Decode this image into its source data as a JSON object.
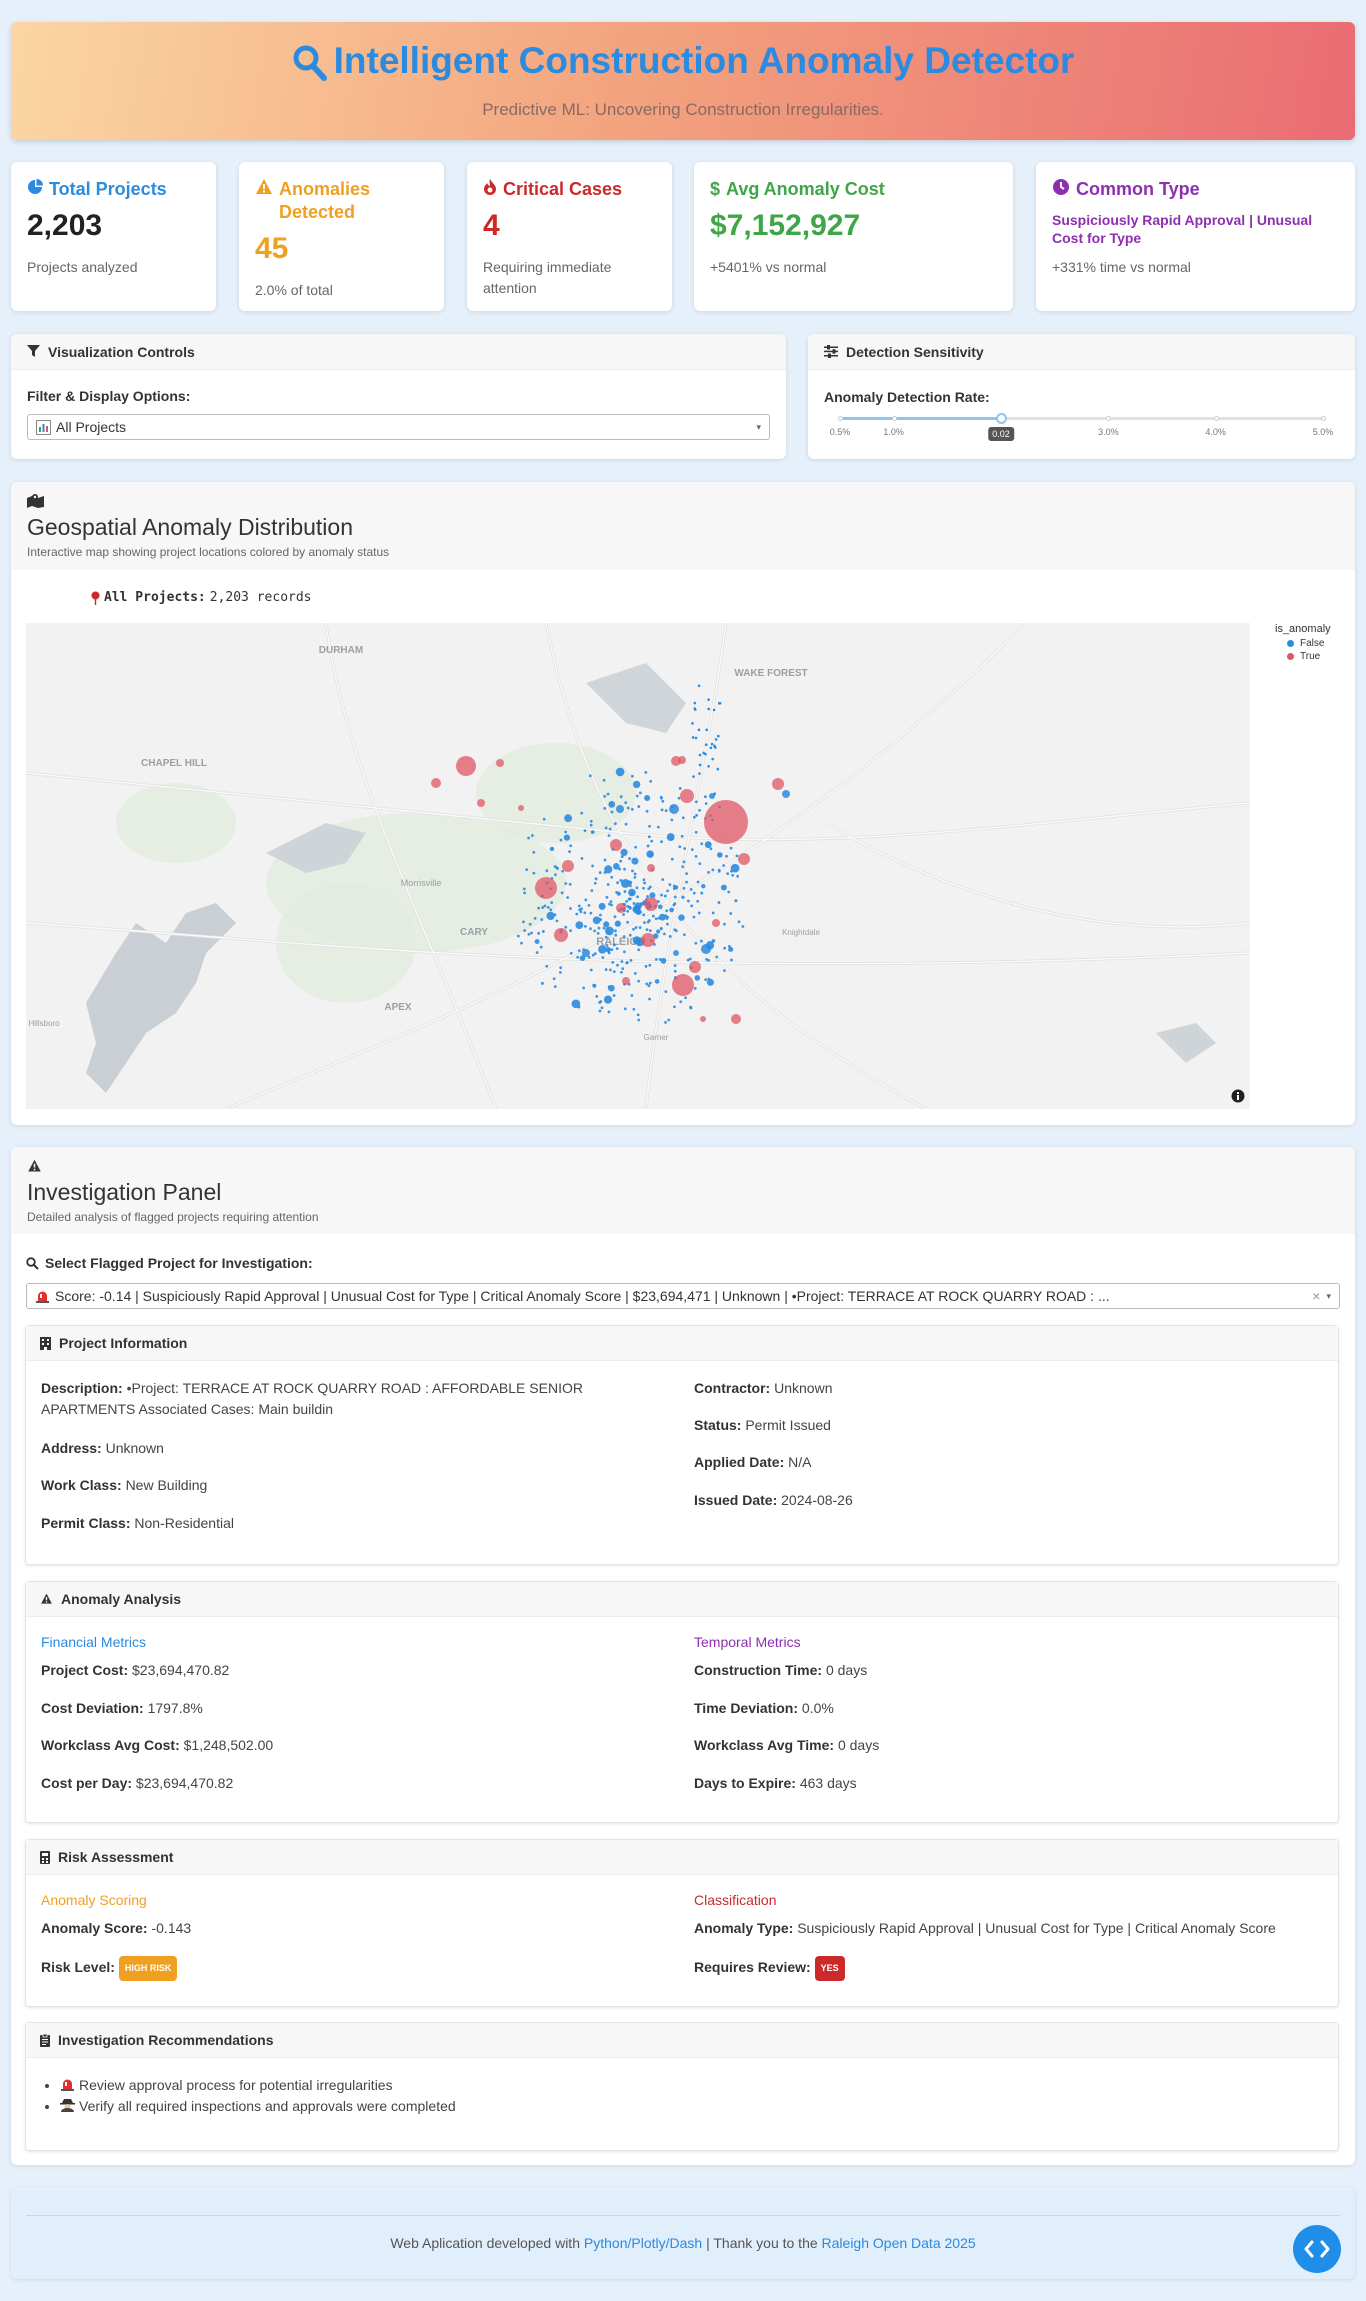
{
  "header": {
    "title": "Intelligent Construction Anomaly Detector",
    "subtitle": "Predictive ML: Uncovering Construction Irregularities."
  },
  "stats": [
    {
      "title": "Total Projects",
      "value": "2,203",
      "desc": "Projects analyzed",
      "color": "#2a8be0",
      "icon": "pie-chart-icon"
    },
    {
      "title": "Anomalies Detected",
      "value": "45",
      "desc": "2.0% of total",
      "color": "#f0a020",
      "icon": "warning-icon"
    },
    {
      "title": "Critical Cases",
      "value": "4",
      "desc": "Requiring immediate attention",
      "color": "#cc2a2a",
      "icon": "fire-icon"
    },
    {
      "title": "Avg Anomaly Cost",
      "value": "$7,152,927",
      "desc": "+5401% vs normal",
      "color": "#3fa648",
      "icon": "dollar-icon"
    },
    {
      "title": "Common Type",
      "value": "Suspiciously Rapid Approval | Unusual Cost for Type",
      "desc": "+331% time vs normal",
      "color": "#8e2fb0",
      "icon": "clock-icon"
    }
  ],
  "controls": {
    "title": "Visualization Controls",
    "filter_label": "Filter & Display Options:",
    "filter_value": "All Projects"
  },
  "sensitivity": {
    "title": "Detection Sensitivity",
    "label": "Anomaly Detection Rate:",
    "ticks": [
      "0.5%",
      "1.0%",
      "2.0%",
      "3.0%",
      "4.0%",
      "5.0%"
    ],
    "value_label": "0.02",
    "value": 0.02
  },
  "map_section": {
    "title": "Geospatial Anomaly Distribution",
    "subtitle": "Interactive map showing project locations colored by anomaly status",
    "records_label": "All Projects:",
    "records_value": "2,203 records",
    "legend_title": "is_anomaly",
    "legend": [
      {
        "name": "False",
        "color": "#2a8be0"
      },
      {
        "name": "True",
        "color": "#e05566"
      }
    ],
    "places": [
      "DURHAM",
      "WAKE FOREST",
      "CHAPEL HILL",
      "Morrisville",
      "CARY",
      "RALEIGH",
      "Knightdale",
      "APEX",
      "Garner",
      "Hillsboro"
    ]
  },
  "investigation": {
    "title": "Investigation Panel",
    "subtitle": "Detailed analysis of flagged projects requiring attention",
    "select_label": "Select Flagged Project for Investigation:",
    "select_value": "Score: -0.14 | Suspiciously Rapid Approval | Unusual Cost for Type | Critical Anomaly Score | $23,694,471 | Unknown | •Project: TERRACE AT ROCK QUARRY ROAD : ...",
    "project_info": {
      "title": "Project Information",
      "description_label": "Description:",
      "description": "•Project: TERRACE AT ROCK QUARRY ROAD : AFFORDABLE SENIOR APARTMENTS Associated Cases: Main buildin",
      "address_label": "Address:",
      "address": "Unknown",
      "workclass_label": "Work Class:",
      "workclass": "New Building",
      "permitclass_label": "Permit Class:",
      "permitclass": "Non-Residential",
      "contractor_label": "Contractor:",
      "contractor": "Unknown",
      "status_label": "Status:",
      "status": "Permit Issued",
      "applied_label": "Applied Date:",
      "applied": "N/A",
      "issued_label": "Issued Date:",
      "issued": "2024-08-26"
    },
    "anomaly_analysis": {
      "title": "Anomaly Analysis",
      "financial_title": "Financial Metrics",
      "temporal_title": "Temporal Metrics",
      "financial": [
        {
          "label": "Project Cost:",
          "value": "$23,694,470.82"
        },
        {
          "label": "Cost Deviation:",
          "value": "1797.8%"
        },
        {
          "label": "Workclass Avg Cost:",
          "value": "$1,248,502.00"
        },
        {
          "label": "Cost per Day:",
          "value": "$23,694,470.82"
        }
      ],
      "temporal": [
        {
          "label": "Construction Time:",
          "value": "0 days"
        },
        {
          "label": "Time Deviation:",
          "value": "0.0%"
        },
        {
          "label": "Workclass Avg Time:",
          "value": "0 days"
        },
        {
          "label": "Days to Expire:",
          "value": "463 days"
        }
      ]
    },
    "risk": {
      "title": "Risk Assessment",
      "scoring_title": "Anomaly Scoring",
      "classification_title": "Classification",
      "score_label": "Anomaly Score:",
      "score": "-0.143",
      "level_label": "Risk Level:",
      "level": "HIGH RISK",
      "type_label": "Anomaly Type:",
      "type": "Suspiciously Rapid Approval | Unusual Cost for Type | Critical Anomaly Score",
      "review_label": "Requires Review:",
      "review": "YES"
    },
    "recommendations": {
      "title": "Investigation Recommendations",
      "items": [
        "Review approval process for potential irregularities",
        "Verify all required inspections and approvals were completed"
      ]
    }
  },
  "footer": {
    "prefix": "Web Aplication developed with",
    "link1": "Python/Plotly/Dash",
    "middle": "| Thank you to the",
    "link2": "Raleigh Open Data 2025"
  }
}
